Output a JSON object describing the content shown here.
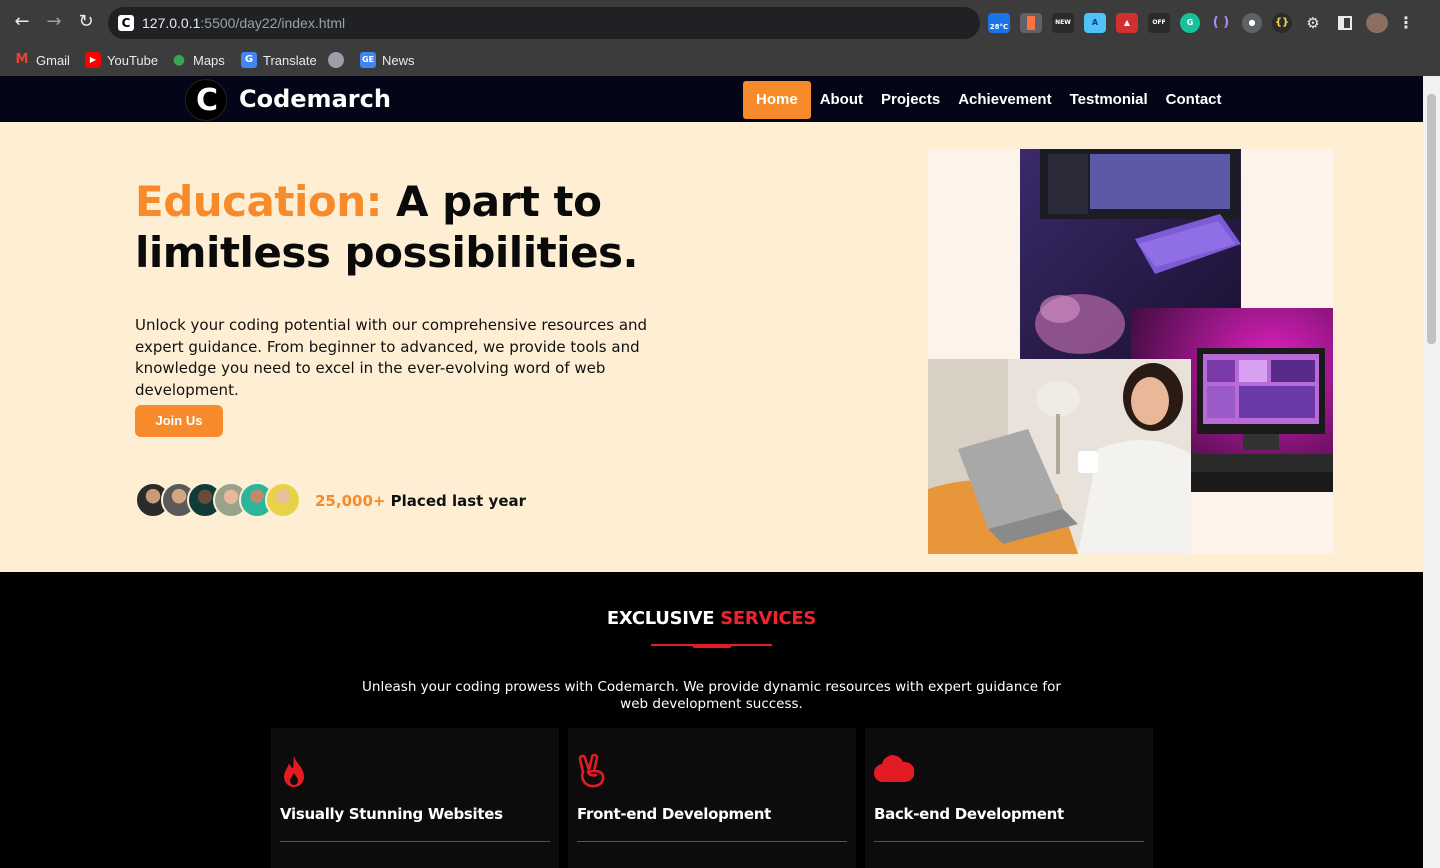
{
  "browser": {
    "url_host": "127.0.0.1",
    "url_rest": ":5500/day22/index.html",
    "favicon_letter": "C",
    "weather_badge": "28°C",
    "extension_labels": [
      "NEW",
      "OFF"
    ],
    "bookmarks": [
      {
        "label": "Gmail",
        "icon": "gmail-icon",
        "color": "#ea4335"
      },
      {
        "label": "YouTube",
        "icon": "youtube-icon",
        "color": "#ff0000"
      },
      {
        "label": "Maps",
        "icon": "maps-icon",
        "color": "#34a853"
      },
      {
        "label": "Translate",
        "icon": "translate-icon",
        "color": "#4285f4"
      },
      {
        "label": "",
        "icon": "globe-icon",
        "color": "#9aa0a6"
      },
      {
        "label": "News",
        "icon": "news-icon",
        "color": "#4285f4"
      }
    ]
  },
  "site": {
    "logo_letter": "C",
    "brand": "Codemarch",
    "menu": [
      {
        "label": "Home",
        "active": true
      },
      {
        "label": "About",
        "active": false
      },
      {
        "label": "Projects",
        "active": false
      },
      {
        "label": "Achievement",
        "active": false
      },
      {
        "label": "Testmonial",
        "active": false
      },
      {
        "label": "Contact",
        "active": false
      }
    ]
  },
  "hero": {
    "heading_accent": "Education:",
    "heading_rest": " A part to limitless possibilities.",
    "paragraph": "Unlock your coding potential with our comprehensive resources and expert guidance. From beginner to advanced, we provide tools and knowledge you need to excel in the ever-evolving word of web development.",
    "cta_label": "Join Us",
    "placed_number": "25,000+",
    "placed_text": " Placed last year"
  },
  "services": {
    "title_white": "EXCLUSIVE",
    "title_red": " SERVICES",
    "description": "Unleash your coding prowess with Codemarch. We provide dynamic resources with expert guidance for web development success.",
    "cards": [
      {
        "title": "Visually Stunning Websites",
        "icon": "fire-icon"
      },
      {
        "title": "Front-end Development",
        "icon": "peace-hand-icon"
      },
      {
        "title": "Back-end Development",
        "icon": "cloud-icon"
      }
    ]
  },
  "colors": {
    "accent_orange": "#f78b2b",
    "accent_red": "#e31b23",
    "hero_bg": "#feefd4",
    "nav_bg": "#040617"
  }
}
